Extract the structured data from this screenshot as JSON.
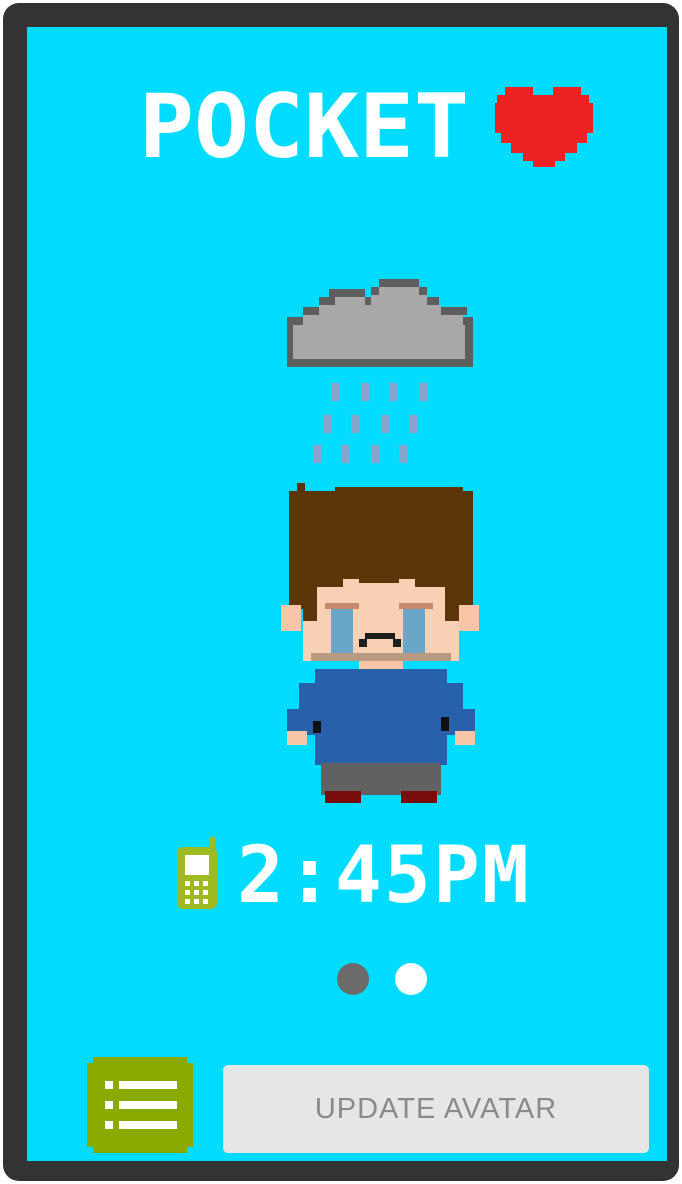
{
  "app": {
    "title": "POCKET"
  },
  "status": {
    "weather_icon": "rain-cloud-icon",
    "mood": "sad-crying",
    "time": "2:45PM",
    "phone_icon": "phone-icon"
  },
  "pager": {
    "active_index": 0,
    "count": 2
  },
  "actions": {
    "menu_icon": "list-icon",
    "update_label": "UPDATE AVATAR"
  },
  "colors": {
    "background": "#00dcff",
    "frame": "#333333",
    "heart": "#ee2222",
    "menu_button": "#8aaa00",
    "phone": "#9dbb20",
    "dot_active": "#6b6b6b",
    "dot_inactive": "#ffffff",
    "button_bg": "#e6e6e6",
    "button_text": "#8a8a8a"
  }
}
